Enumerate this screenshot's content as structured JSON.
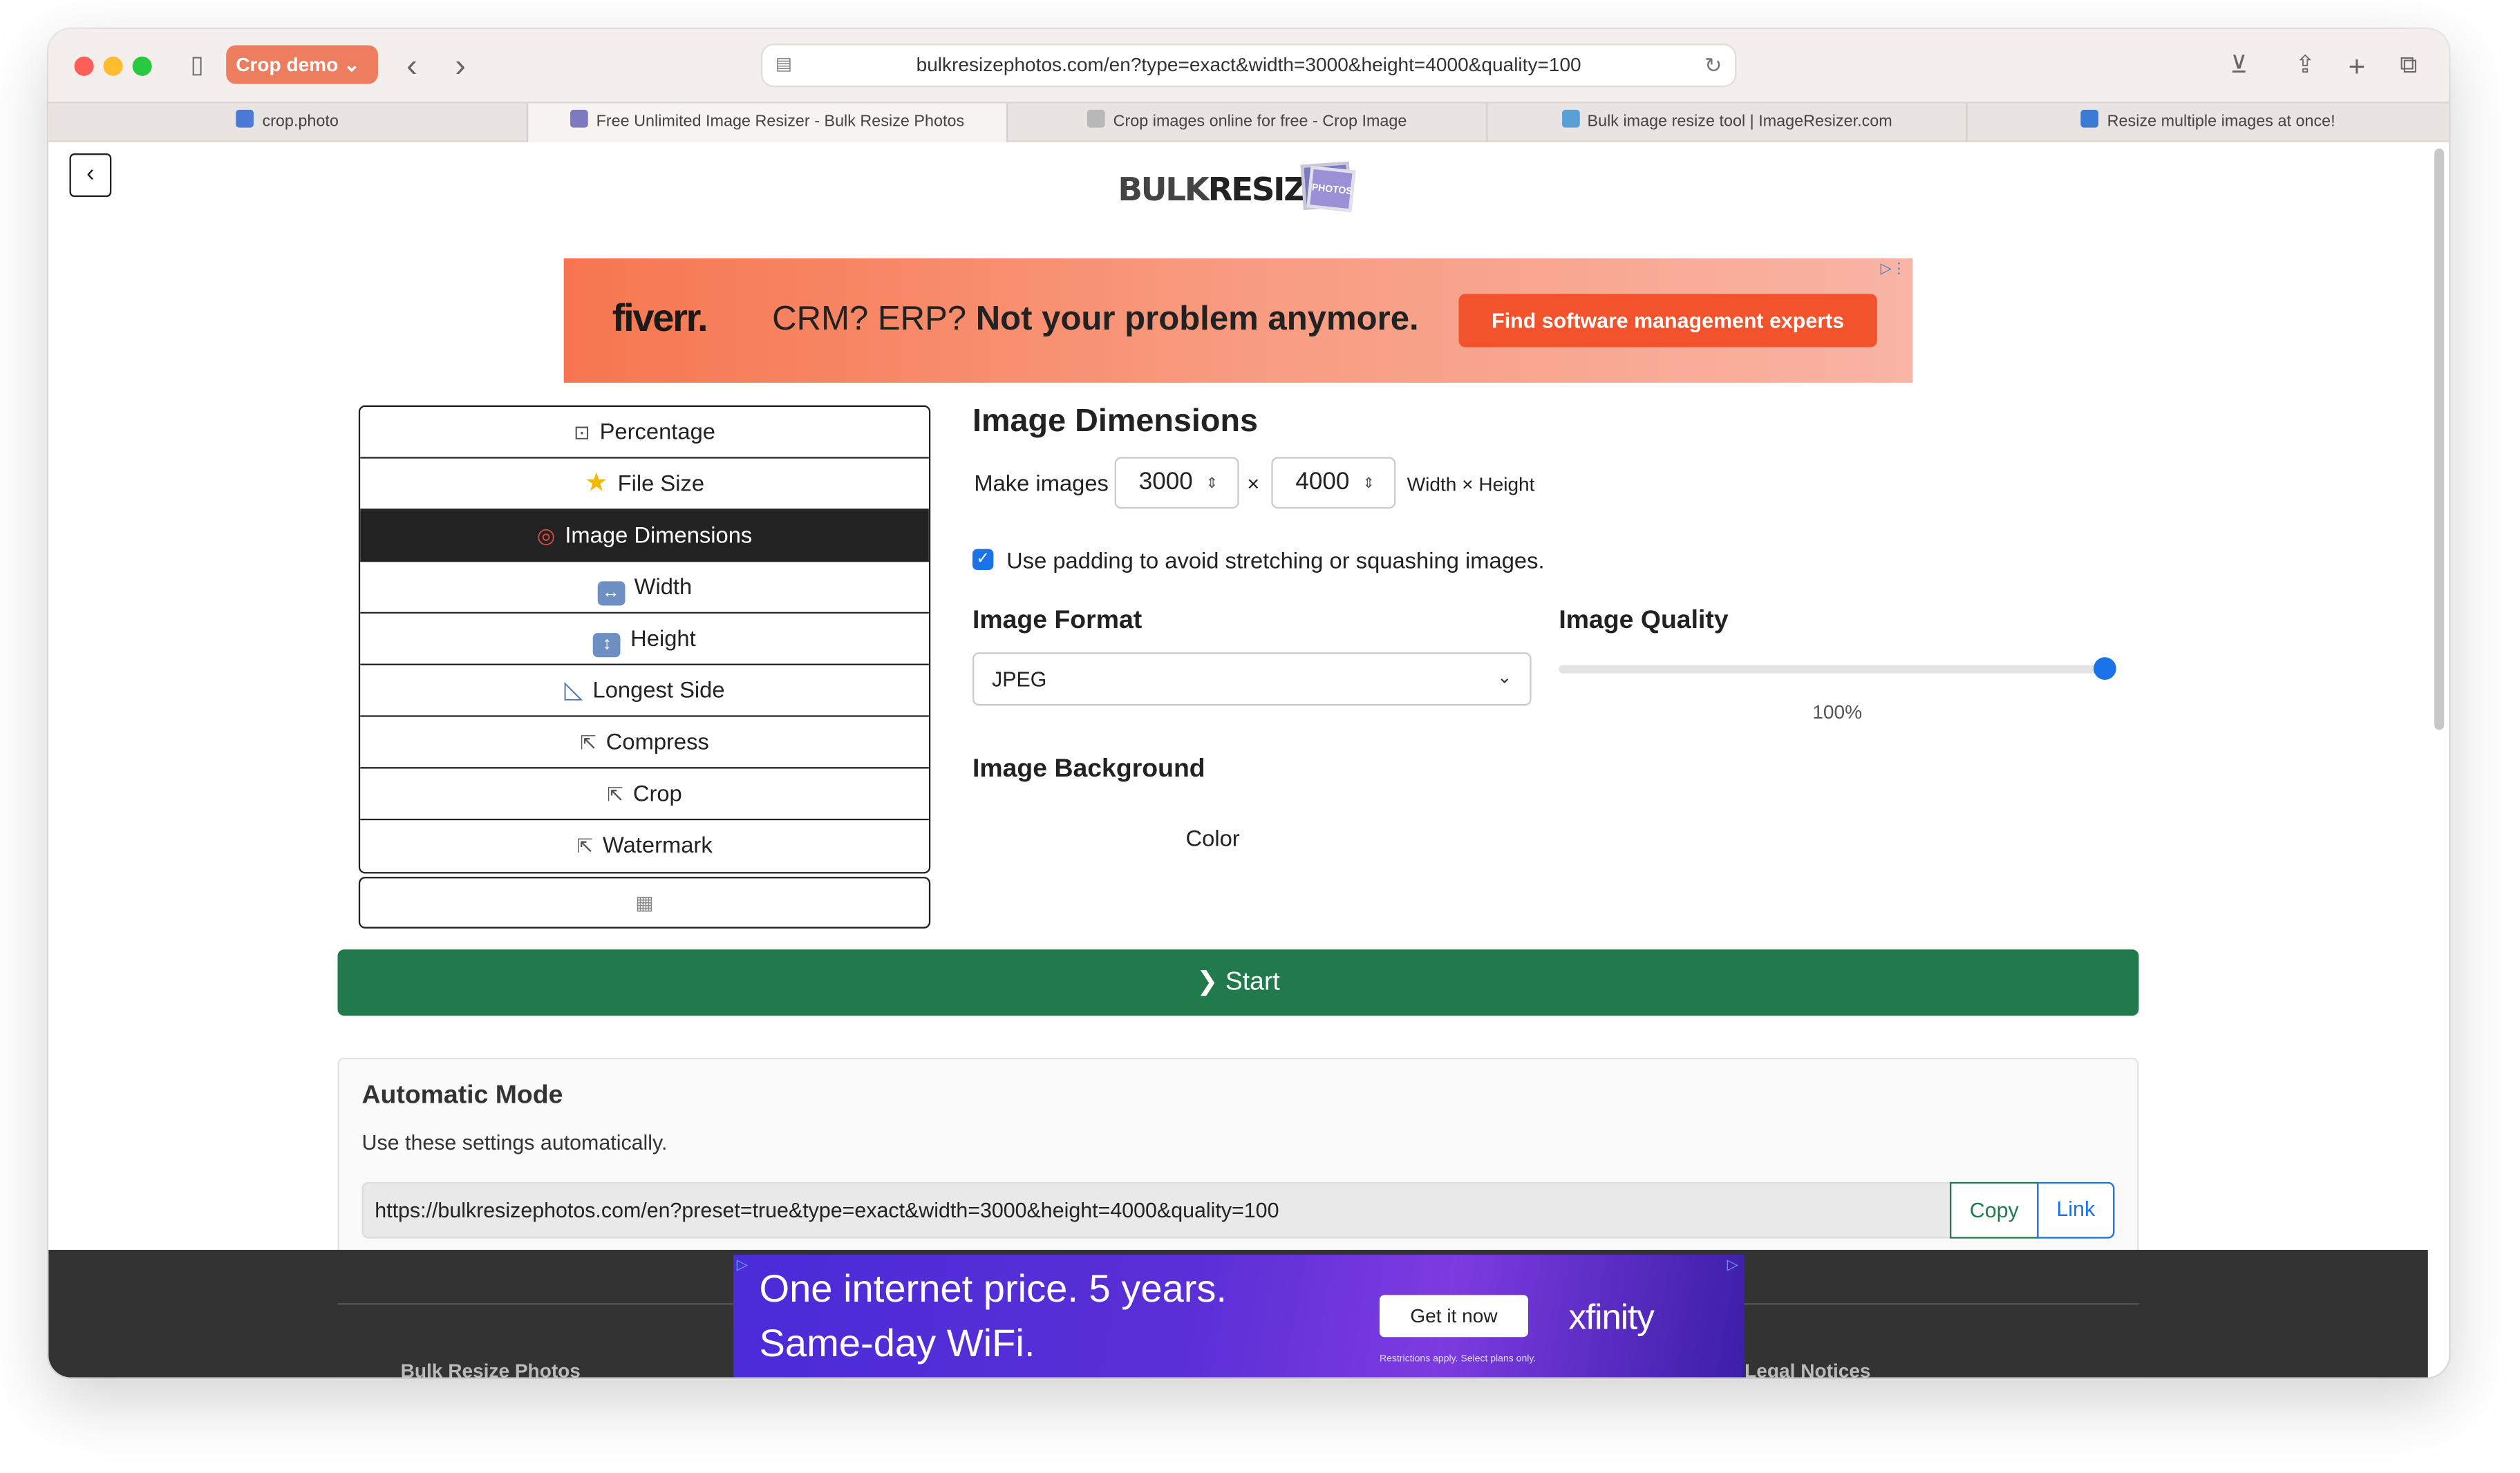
{
  "browser": {
    "group_label": "Crop demo",
    "url": "bulkresizephotos.com/en?type=exact&width=3000&height=4000&quality=100",
    "tabs": [
      {
        "title": "crop.photo",
        "active": false,
        "favicon_color": "#4a7bd6"
      },
      {
        "title": "Free Unlimited Image Resizer - Bulk Resize Photos",
        "active": true,
        "favicon_color": "#7e7ac2"
      },
      {
        "title": "Crop images online for free - Crop Image",
        "active": false,
        "favicon_color": "#b8b8b8"
      },
      {
        "title": "Bulk image resize tool | ImageResizer.com",
        "active": false,
        "favicon_color": "#5aa0d8"
      },
      {
        "title": "Resize multiple images at once!",
        "active": false,
        "favicon_color": "#3b7bd5"
      }
    ],
    "icons": [
      "sidebar-icon",
      "back-icon",
      "forward-icon",
      "download-icon",
      "share-icon",
      "new-tab-icon",
      "tab-overview-icon"
    ]
  },
  "page": {
    "back_label": "‹",
    "logo": {
      "prefix": "BULK",
      "word": "RESIZE",
      "badge": "PHOTOS"
    },
    "ad_top": {
      "brand": "fiverr.",
      "text_plain": "CRM? ERP? ",
      "text_bold": "Not your problem anymore.",
      "cta": "Find software management experts"
    },
    "menu": [
      {
        "label": "Percentage",
        "icon": "percentage-icon",
        "glyph": "⊡",
        "active": false
      },
      {
        "label": "File Size",
        "icon": "star-icon",
        "glyph": "★",
        "active": false
      },
      {
        "label": "Image Dimensions",
        "icon": "target-icon",
        "glyph": "◎",
        "active": true
      },
      {
        "label": "Width",
        "icon": "width-arrows-icon",
        "glyph": "↔",
        "active": false
      },
      {
        "label": "Height",
        "icon": "height-arrows-icon",
        "glyph": "↕",
        "active": false
      },
      {
        "label": "Longest Side",
        "icon": "ruler-icon",
        "glyph": "◺",
        "active": false
      },
      {
        "label": "Compress",
        "icon": "external-link-icon",
        "glyph": "⇱",
        "active": false
      },
      {
        "label": "Crop",
        "icon": "external-link-icon",
        "glyph": "⇱",
        "active": false
      },
      {
        "label": "Watermark",
        "icon": "external-link-icon",
        "glyph": "⇱",
        "active": false
      }
    ],
    "extra_button_glyph": "▦",
    "dimensions": {
      "heading": "Image Dimensions",
      "make_label": "Make images",
      "width": "3000",
      "height": "4000",
      "times": "×",
      "units_label": "Width × Height",
      "padding_checked": true,
      "padding_label": "Use padding to avoid stretching or squashing images."
    },
    "format": {
      "heading": "Image Format",
      "selected": "JPEG"
    },
    "quality": {
      "heading": "Image Quality",
      "value_pct": 100,
      "value_label": "100%"
    },
    "background": {
      "heading": "Image Background",
      "color_label": "Color"
    },
    "start_label": "❯ Start",
    "automatic": {
      "heading": "Automatic Mode",
      "description": "Use these settings automatically.",
      "url": "https://bulkresizephotos.com/en?preset=true&type=exact&width=3000&height=4000&quality=100",
      "copy_label": "Copy",
      "link_label": "Link"
    },
    "footer": {
      "left_label": "Bulk Resize Photos",
      "right_label": "Legal Notices"
    },
    "ad_bottom": {
      "line1": "One internet price. 5 years.",
      "line2": "Same-day WiFi.",
      "cta": "Get it now",
      "brand": "xfinity",
      "fine_print": "Restrictions apply. Select plans only."
    }
  }
}
